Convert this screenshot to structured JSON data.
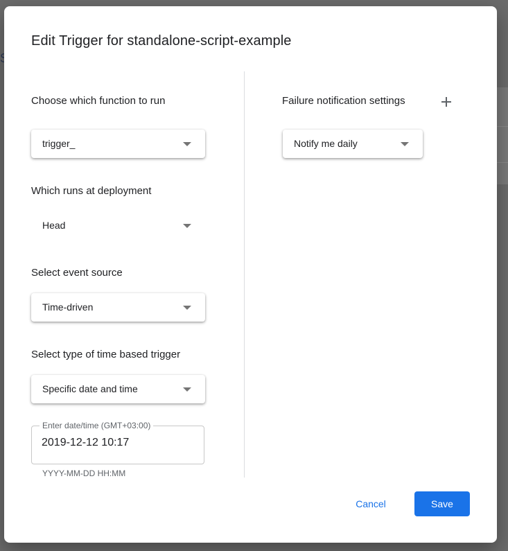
{
  "dialog": {
    "title": "Edit Trigger for standalone-script-example"
  },
  "function_field": {
    "label": "Choose which function to run",
    "value": "trigger_"
  },
  "deployment_field": {
    "label": "Which runs at deployment",
    "value": "Head"
  },
  "event_source_field": {
    "label": "Select event source",
    "value": "Time-driven"
  },
  "trigger_type_field": {
    "label": "Select type of time based trigger",
    "value": "Specific date and time"
  },
  "datetime_field": {
    "label": "Enter date/time (GMT+03:00)",
    "value": "2019-12-12 10:17",
    "hint": "YYYY-MM-DD HH:MM"
  },
  "failure_notification": {
    "label": "Failure notification settings",
    "value": "Notify me daily"
  },
  "actions": {
    "cancel_label": "Cancel",
    "save_label": "Save"
  },
  "colors": {
    "accent": "#1a73e8",
    "text": "#202124",
    "secondary_text": "#5f6368",
    "overlay": "#6b6b6b"
  },
  "icons": {
    "add": "plus-icon",
    "dropdown": "caret-down-icon"
  }
}
